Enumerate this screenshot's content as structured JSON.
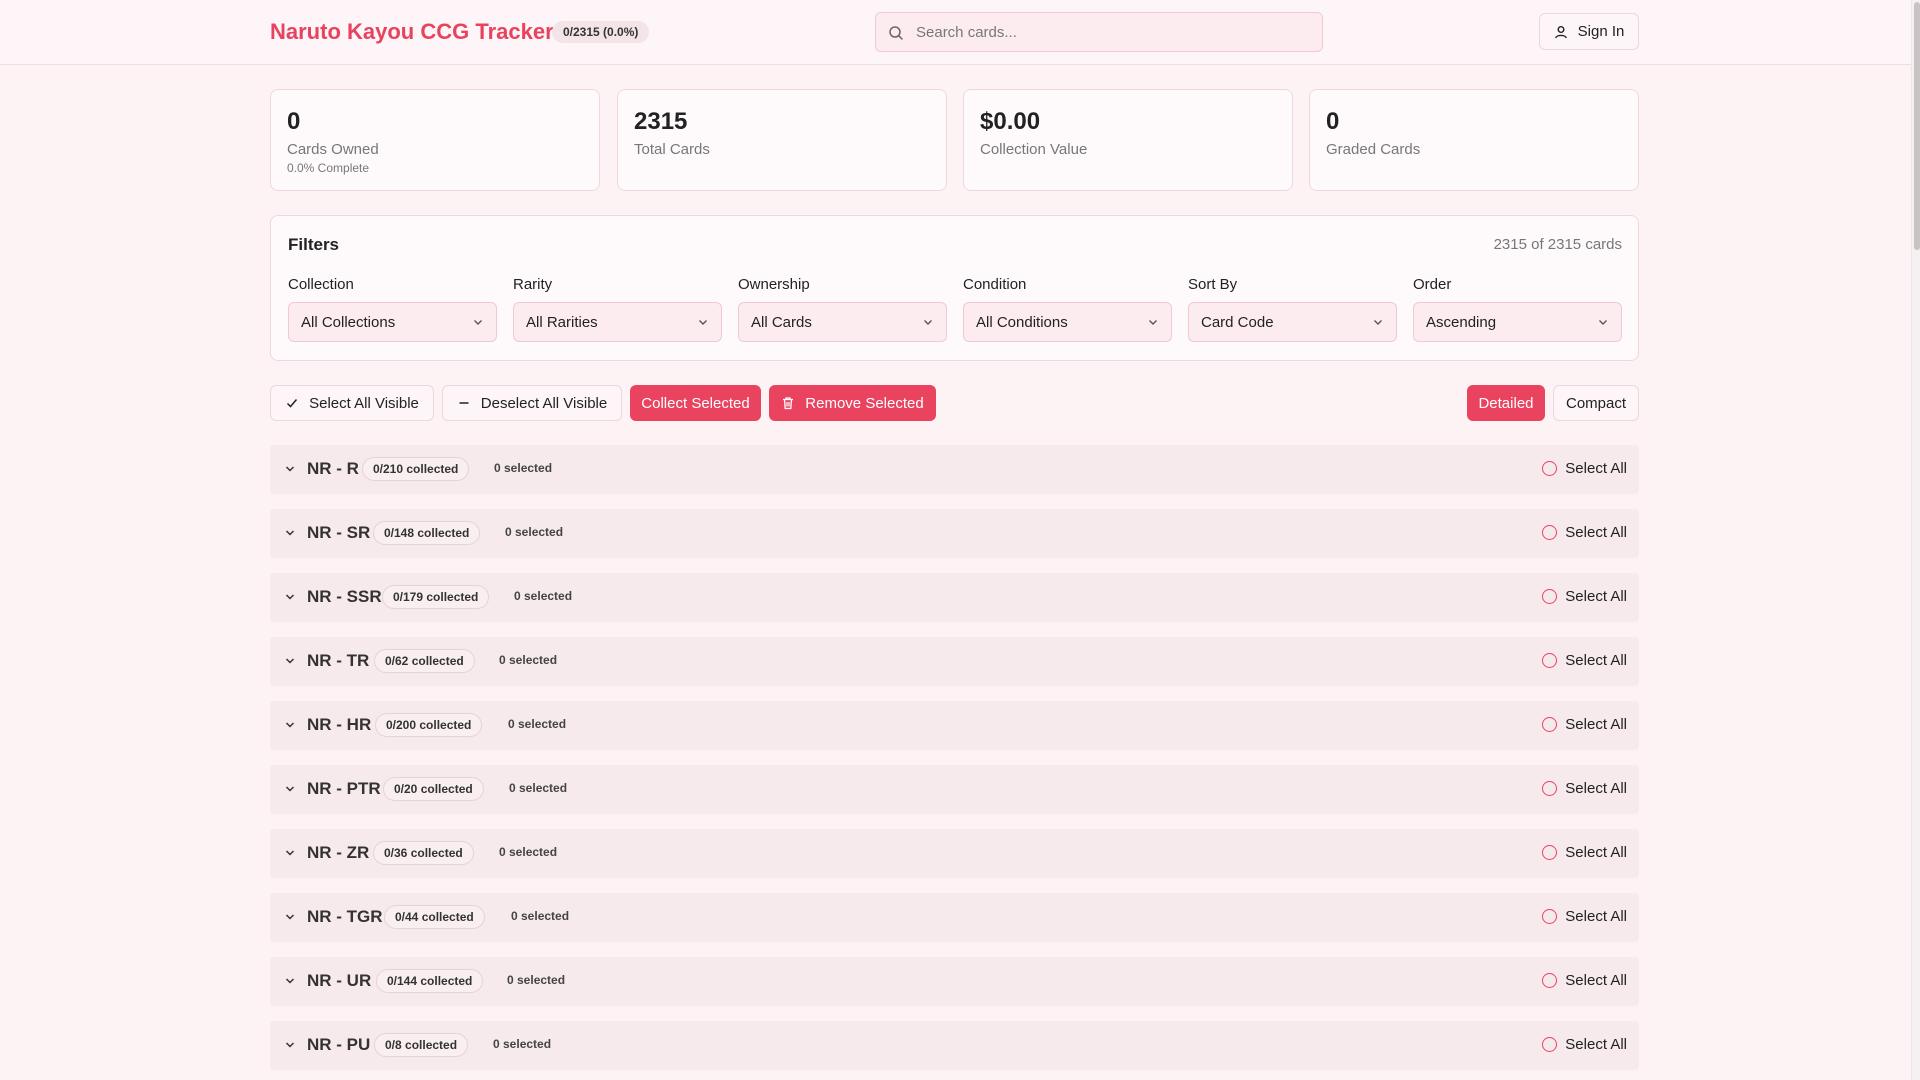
{
  "header": {
    "title": "Naruto Kayou CCG Tracker",
    "progress_badge": "0/2315 (0.0%)",
    "search_placeholder": "Search cards...",
    "signin_label": "Sign In"
  },
  "stats": [
    {
      "value": "0",
      "label": "Cards Owned",
      "sub": "0.0% Complete"
    },
    {
      "value": "2315",
      "label": "Total Cards",
      "sub": ""
    },
    {
      "value": "$0.00",
      "label": "Collection Value",
      "sub": ""
    },
    {
      "value": "0",
      "label": "Graded Cards",
      "sub": ""
    }
  ],
  "filters": {
    "title": "Filters",
    "count": "2315 of 2315 cards",
    "fields": [
      {
        "label": "Collection",
        "value": "All Collections"
      },
      {
        "label": "Rarity",
        "value": "All Rarities"
      },
      {
        "label": "Ownership",
        "value": "All Cards"
      },
      {
        "label": "Condition",
        "value": "All Conditions"
      },
      {
        "label": "Sort By",
        "value": "Card Code"
      },
      {
        "label": "Order",
        "value": "Ascending"
      }
    ]
  },
  "actions": {
    "select_all": "Select All Visible",
    "deselect_all": "Deselect All Visible",
    "collect": "Collect Selected",
    "remove": "Remove Selected",
    "view_detailed": "Detailed",
    "view_compact": "Compact"
  },
  "groups": [
    {
      "name": "NR - R",
      "collected": "0/210 collected",
      "selected": "0 selected",
      "select_all": "Select All"
    },
    {
      "name": "NR - SR",
      "collected": "0/148 collected",
      "selected": "0 selected",
      "select_all": "Select All"
    },
    {
      "name": "NR - SSR",
      "collected": "0/179 collected",
      "selected": "0 selected",
      "select_all": "Select All"
    },
    {
      "name": "NR - TR",
      "collected": "0/62 collected",
      "selected": "0 selected",
      "select_all": "Select All"
    },
    {
      "name": "NR - HR",
      "collected": "0/200 collected",
      "selected": "0 selected",
      "select_all": "Select All"
    },
    {
      "name": "NR - PTR",
      "collected": "0/20 collected",
      "selected": "0 selected",
      "select_all": "Select All"
    },
    {
      "name": "NR - ZR",
      "collected": "0/36 collected",
      "selected": "0 selected",
      "select_all": "Select All"
    },
    {
      "name": "NR - TGR",
      "collected": "0/44 collected",
      "selected": "0 selected",
      "select_all": "Select All"
    },
    {
      "name": "NR - UR",
      "collected": "0/144 collected",
      "selected": "0 selected",
      "select_all": "Select All"
    },
    {
      "name": "NR - PU",
      "collected": "0/8 collected",
      "selected": "0 selected",
      "select_all": "Select All"
    }
  ],
  "colors": {
    "accent": "#ea4360",
    "background": "#fdf3f5"
  }
}
